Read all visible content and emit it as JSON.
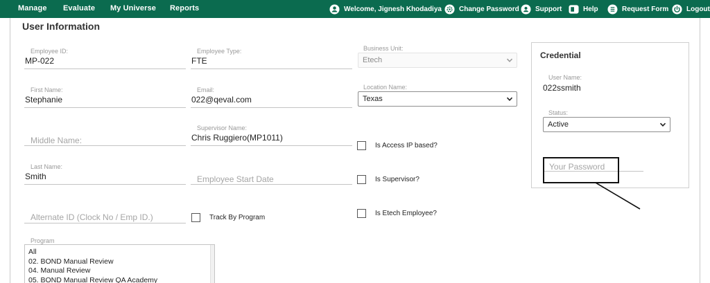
{
  "nav": {
    "left": [
      "Manage",
      "Evaluate",
      "My Universe",
      "Reports"
    ],
    "welcome": "Welcome, Jignesh Khodadiya",
    "change_password": "Change Password",
    "support": "Support",
    "help": "Help",
    "request_form": "Request Form",
    "logout": "Logout",
    "color": "#0b6b4f"
  },
  "page_title": "User Information",
  "form": {
    "employee_id": {
      "label": "Employee ID:",
      "value": "MP-022"
    },
    "employee_type": {
      "label": "Employee Type:",
      "value": "FTE"
    },
    "business_unit": {
      "label": "Business Unit:",
      "value": "Etech"
    },
    "first_name": {
      "label": "First Name:",
      "value": "Stephanie"
    },
    "email": {
      "label": "Email:",
      "value": "022@qeval.com"
    },
    "location_name": {
      "label": "Location Name:",
      "value": "Texas"
    },
    "middle_name": {
      "placeholder": "Middle Name:"
    },
    "supervisor_name": {
      "label": "Supervisor Name:",
      "value": "Chris Ruggiero(MP1011)"
    },
    "access_ip": {
      "label": "Is Access IP based?"
    },
    "last_name": {
      "label": "Last Name:",
      "value": "Smith"
    },
    "employee_start_date": {
      "placeholder": "Employee Start Date"
    },
    "is_supervisor": {
      "label": "Is Supervisor?"
    },
    "alternate_id": {
      "placeholder": "Alternate ID (Clock No / Emp ID.)"
    },
    "track_by_program": {
      "label": "Track By Program"
    },
    "is_etech_employee": {
      "label": "Is Etech Employee?"
    },
    "program": {
      "label": "Program",
      "options": [
        "All",
        "02. BOND Manual Review",
        "04. Manual Review",
        "05. BOND Manual Review QA Academy"
      ]
    }
  },
  "credential": {
    "title": "Credential",
    "user_name_label": "User Name:",
    "user_name": "022ssmith",
    "status_label": "Status:",
    "status": "Active",
    "password_placeholder": "Your Password"
  }
}
